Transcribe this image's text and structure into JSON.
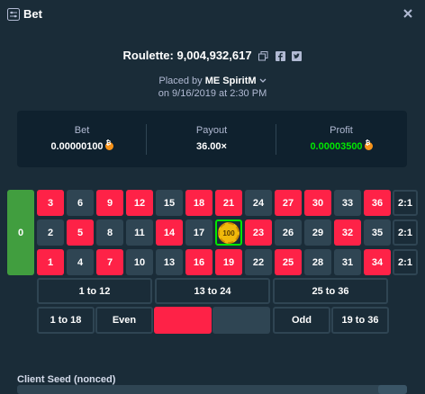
{
  "header": {
    "title": "Bet"
  },
  "bet_title": "Roulette: 9,004,932,617",
  "placed_by": {
    "prefix": "Placed by ",
    "user": "ME SpiritM",
    "date": "on 9/16/2019 at 2:30 PM"
  },
  "stats": {
    "bet_label": "Bet",
    "bet_value": "0.00000100",
    "payout_label": "Payout",
    "payout_value": "36.00×",
    "profit_label": "Profit",
    "profit_value": "0.00003500"
  },
  "table": {
    "zero": "0",
    "rows": [
      [
        {
          "n": "3",
          "c": "red"
        },
        {
          "n": "6",
          "c": "black"
        },
        {
          "n": "9",
          "c": "red"
        },
        {
          "n": "12",
          "c": "red"
        },
        {
          "n": "15",
          "c": "black"
        },
        {
          "n": "18",
          "c": "red"
        },
        {
          "n": "21",
          "c": "red"
        },
        {
          "n": "24",
          "c": "black"
        },
        {
          "n": "27",
          "c": "red"
        },
        {
          "n": "30",
          "c": "red"
        },
        {
          "n": "33",
          "c": "black"
        },
        {
          "n": "36",
          "c": "red"
        }
      ],
      [
        {
          "n": "2",
          "c": "black"
        },
        {
          "n": "5",
          "c": "red"
        },
        {
          "n": "8",
          "c": "black"
        },
        {
          "n": "11",
          "c": "black"
        },
        {
          "n": "14",
          "c": "red"
        },
        {
          "n": "17",
          "c": "black"
        },
        {
          "n": "20",
          "c": "black"
        },
        {
          "n": "23",
          "c": "red"
        },
        {
          "n": "26",
          "c": "black"
        },
        {
          "n": "29",
          "c": "black"
        },
        {
          "n": "32",
          "c": "red"
        },
        {
          "n": "35",
          "c": "black"
        }
      ],
      [
        {
          "n": "1",
          "c": "red"
        },
        {
          "n": "4",
          "c": "black"
        },
        {
          "n": "7",
          "c": "red"
        },
        {
          "n": "10",
          "c": "black"
        },
        {
          "n": "13",
          "c": "black"
        },
        {
          "n": "16",
          "c": "red"
        },
        {
          "n": "19",
          "c": "red"
        },
        {
          "n": "22",
          "c": "black"
        },
        {
          "n": "25",
          "c": "red"
        },
        {
          "n": "28",
          "c": "black"
        },
        {
          "n": "31",
          "c": "black"
        },
        {
          "n": "34",
          "c": "red"
        }
      ]
    ],
    "column_bets": [
      "2:1",
      "2:1",
      "2:1"
    ],
    "dozens": [
      "1 to 12",
      "13 to 24",
      "25 to 36"
    ],
    "outside": [
      "1 to 18",
      "Even",
      "",
      "",
      "Odd",
      "19 to 36"
    ],
    "chip_value": "100",
    "chip_on": "20"
  },
  "client_seed_label": "Client Seed (nonced)",
  "colors": {
    "red": "#fe2247",
    "black": "#2f4553",
    "green": "#419e3f",
    "profit": "#00e701",
    "bg": "#1a2c38",
    "panel": "#0f212e"
  }
}
